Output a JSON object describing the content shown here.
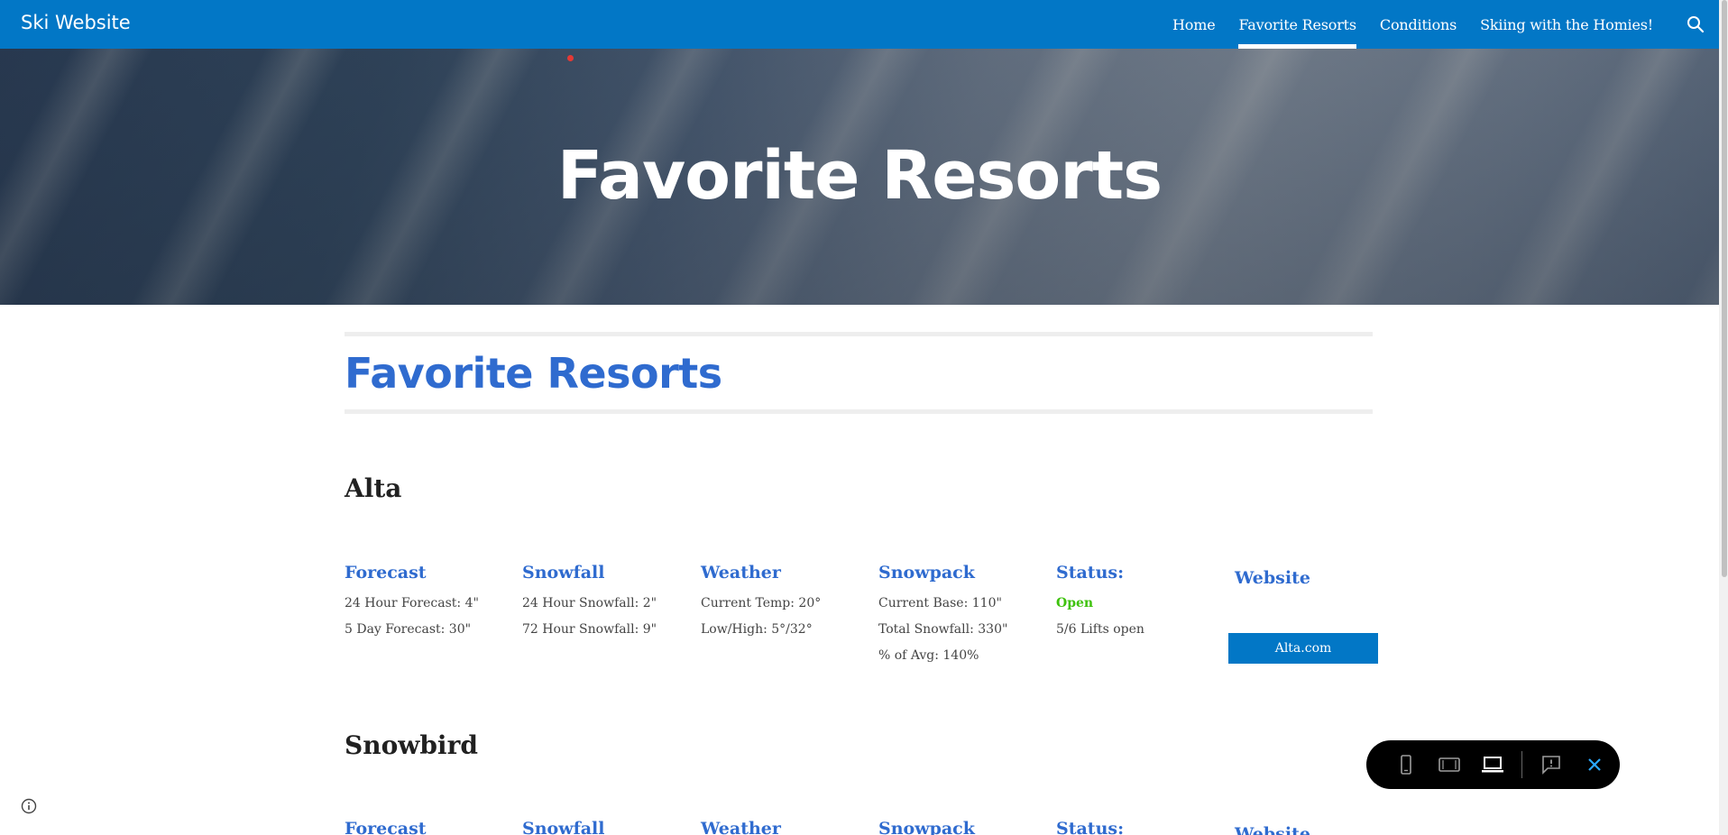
{
  "header": {
    "site_title": "Ski Website",
    "nav": [
      {
        "label": "Home",
        "active": false
      },
      {
        "label": "Favorite Resorts",
        "active": true
      },
      {
        "label": "Conditions",
        "active": false
      },
      {
        "label": "Skiing with the Homies!",
        "active": false
      }
    ],
    "search_icon": "search-icon"
  },
  "hero": {
    "title": "Favorite Resorts"
  },
  "page": {
    "heading": "Favorite Resorts"
  },
  "resorts": [
    {
      "name": "Alta",
      "columns": [
        {
          "title": "Forecast",
          "lines": [
            "24 Hour Forecast: 4\"",
            "5 Day Forecast: 30\""
          ]
        },
        {
          "title": "Snowfall",
          "lines": [
            "24 Hour Snowfall: 2\"",
            "72 Hour Snowfall: 9\""
          ]
        },
        {
          "title": "Weather",
          "lines": [
            "Current Temp: 20°",
            "Low/High: 5°/32°"
          ]
        },
        {
          "title": "Snowpack",
          "lines": [
            "Current Base: 110\"",
            "Total Snowfall: 330\"",
            "% of Avg: 140%"
          ]
        },
        {
          "title": "Status:",
          "status": "Open",
          "lines": [
            "5/6 Lifts open"
          ]
        },
        {
          "title": "Website",
          "button": "Alta.com"
        }
      ]
    },
    {
      "name": "Snowbird",
      "columns": [
        {
          "title": "Forecast"
        },
        {
          "title": "Snowfall"
        },
        {
          "title": "Weather"
        },
        {
          "title": "Snowpack"
        },
        {
          "title": "Status:"
        },
        {
          "title": "Website"
        }
      ]
    }
  ],
  "colors": {
    "brand": "#0277c6",
    "heading": "#2f6bcf",
    "status_open": "#3ec20c"
  },
  "preview_toolbar": {
    "icons": [
      "phone-view-icon",
      "tablet-view-icon",
      "laptop-view-icon",
      "report-abuse-icon",
      "close-icon"
    ]
  }
}
